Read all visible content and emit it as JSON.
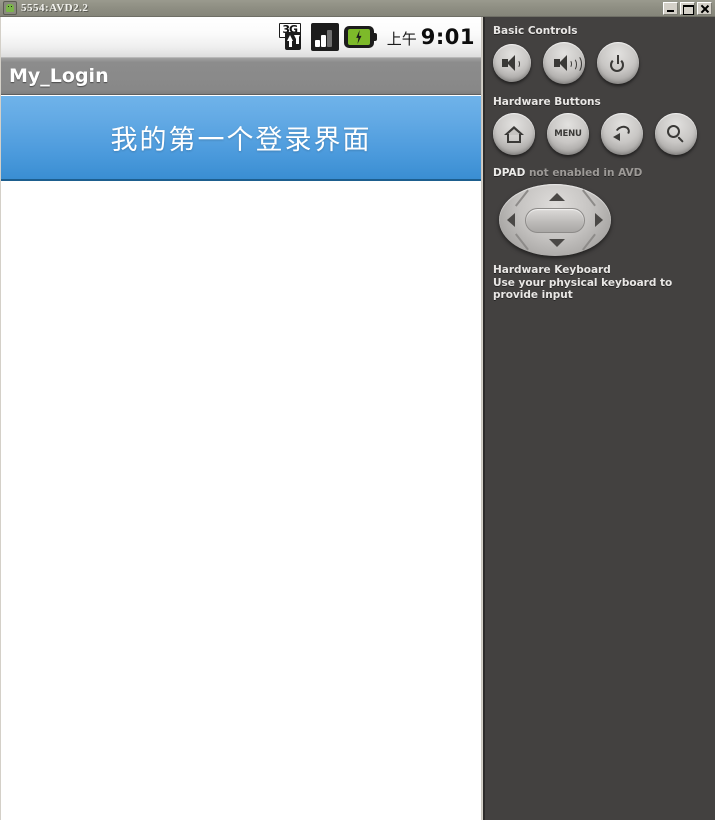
{
  "window": {
    "title": "5554:AVD2.2",
    "icon": "android-robot-icon",
    "buttons": {
      "minimize": "minimize-button",
      "maximize": "maximize-button",
      "close": "close-button"
    }
  },
  "phone": {
    "statusbar": {
      "network_icon": "3g-signal-icon",
      "network_label": "3G",
      "signal_icon": "signal-bars-icon",
      "battery_icon": "battery-charging-icon",
      "ampm": "上午",
      "time": "9:01"
    },
    "app": {
      "title": "My_Login",
      "banner_text": "我的第一个登录界面",
      "banner_color_top": "#6fb3ea",
      "banner_color_bottom": "#3a8ed2",
      "body_color": "#ffffff"
    }
  },
  "panel": {
    "background": "#434140",
    "basic_controls": {
      "label": "Basic Controls",
      "buttons": [
        {
          "name": "volume-down-button",
          "icon": "speaker-low-icon"
        },
        {
          "name": "volume-up-button",
          "icon": "speaker-high-icon"
        },
        {
          "name": "power-button",
          "icon": "power-icon"
        }
      ]
    },
    "hardware_buttons": {
      "label": "Hardware Buttons",
      "buttons": [
        {
          "name": "home-button",
          "icon": "home-icon",
          "label": ""
        },
        {
          "name": "menu-button",
          "icon": "menu-text-icon",
          "label": "MENU"
        },
        {
          "name": "back-button",
          "icon": "back-arrow-icon",
          "label": ""
        },
        {
          "name": "search-button",
          "icon": "search-icon",
          "label": ""
        }
      ]
    },
    "dpad": {
      "label_strong": "DPAD",
      "label_rest": " not enabled in AVD",
      "arrows": [
        "up",
        "down",
        "left",
        "right"
      ],
      "center": "dpad-center-button"
    },
    "keyboard": {
      "title": "Hardware Keyboard",
      "subtitle": "Use your physical keyboard to provide input"
    }
  }
}
